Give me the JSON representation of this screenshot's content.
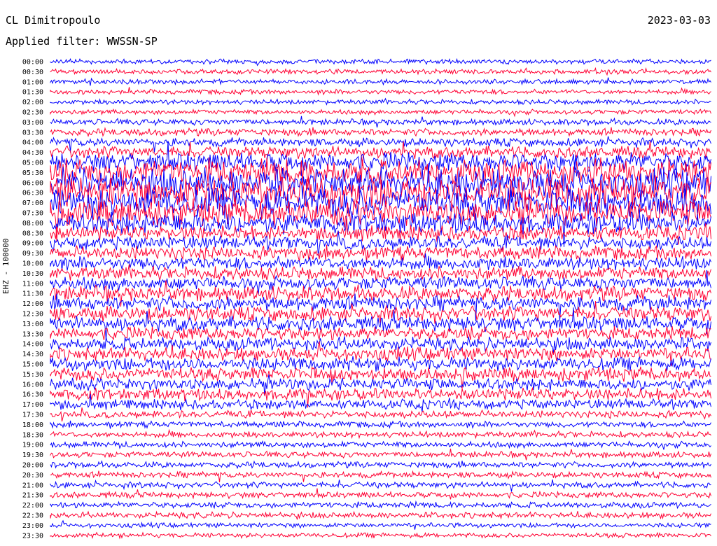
{
  "header": {
    "station": "CL Dimitropoulo",
    "filter": "Applied filter: WWSSN-SP",
    "date": "2023-03-03",
    "channel": "EHZ - 100000"
  },
  "colors": {
    "trace_a": "#0000ff",
    "trace_b": "#ff0033",
    "background": "#ffffff",
    "text": "#000000"
  },
  "chart_data": {
    "type": "line",
    "title": "CL Dimitropoulo",
    "subtitle": "Applied filter: WWSSN-SP",
    "date": "2023-03-03",
    "ylabel": "EHZ - 100000",
    "xlabel": "",
    "row_labels": [
      "00:00",
      "00:30",
      "01:00",
      "01:30",
      "02:00",
      "02:30",
      "03:00",
      "03:30",
      "04:00",
      "04:30",
      "05:00",
      "05:30",
      "06:00",
      "06:30",
      "07:00",
      "07:30",
      "08:00",
      "08:30",
      "09:00",
      "09:30",
      "10:00",
      "10:30",
      "11:00",
      "11:30",
      "12:00",
      "12:30",
      "13:00",
      "13:30",
      "14:00",
      "14:30",
      "15:00",
      "15:30",
      "16:00",
      "16:30",
      "17:00",
      "17:30",
      "18:00",
      "18:30",
      "19:00",
      "19:30",
      "20:00",
      "20:30",
      "21:00",
      "21:30",
      "22:00",
      "22:30",
      "23:00",
      "23:30"
    ],
    "row_amplitude": [
      4,
      4,
      4,
      4,
      4,
      4,
      5,
      6,
      7,
      10,
      16,
      22,
      24,
      26,
      24,
      22,
      18,
      12,
      11,
      11,
      11,
      11,
      11,
      12,
      12,
      12,
      12,
      11,
      11,
      11,
      11,
      11,
      10,
      10,
      8,
      6,
      5,
      5,
      5,
      5,
      5,
      5,
      5,
      5,
      5,
      5,
      4,
      4
    ],
    "row_colors_cycle": [
      "#0000ff",
      "#ff0033"
    ]
  }
}
